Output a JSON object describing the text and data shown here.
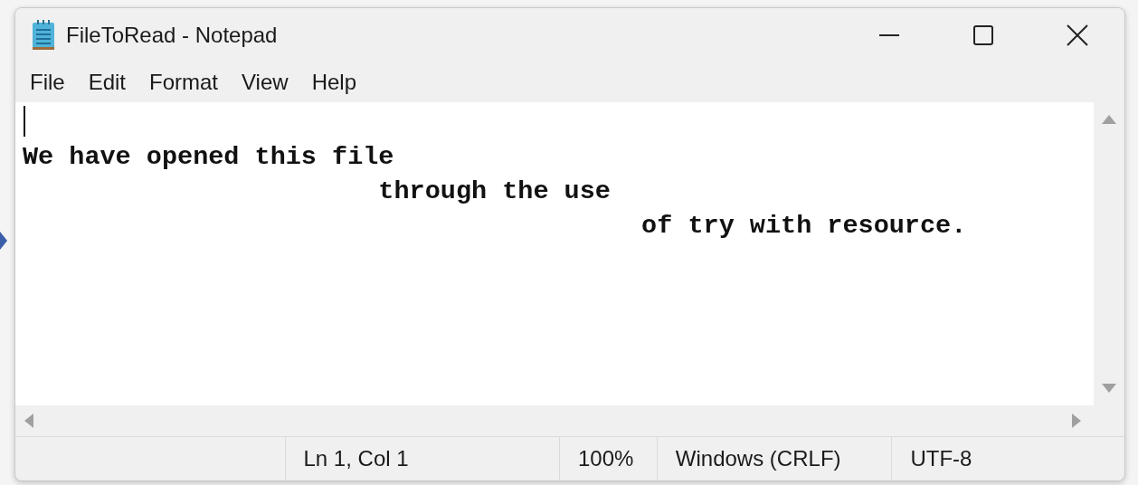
{
  "window": {
    "title": "FileToRead - Notepad"
  },
  "menu": [
    "File",
    "Edit",
    "Format",
    "View",
    "Help"
  ],
  "editor": {
    "lines": [
      "We have opened this file",
      "                       through the use",
      "                                        of try with resource."
    ]
  },
  "status_bar": [
    "Ln 1, Col 1",
    "100%",
    "Windows (CRLF)",
    "UTF-8"
  ]
}
